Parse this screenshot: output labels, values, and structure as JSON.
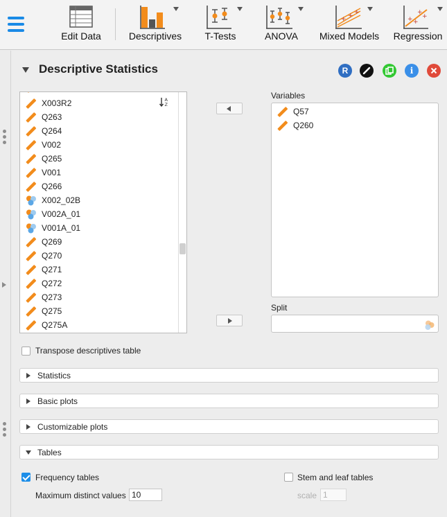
{
  "ribbon": {
    "menu_icon": "hamburger-menu-icon",
    "buttons": [
      {
        "label": "Edit Data",
        "icon": "table-grid-icon"
      },
      {
        "label": "Descriptives",
        "icon": "bar-chart-icon"
      },
      {
        "label": "T-Tests",
        "icon": "t-test-icon"
      },
      {
        "label": "ANOVA",
        "icon": "anova-icon"
      },
      {
        "label": "Mixed Models",
        "icon": "mixed-models-icon"
      },
      {
        "label": "Regression",
        "icon": "regression-icon"
      }
    ],
    "accent_color": "#f28c1c",
    "menu_color": "#1a8ae6"
  },
  "analysis": {
    "title": "Descriptive Statistics",
    "header_icons": [
      {
        "name": "r-syntax-icon",
        "glyph": "R",
        "color": "#2f6ec2"
      },
      {
        "name": "edit-title-icon",
        "glyph": "",
        "color": "#111111"
      },
      {
        "name": "duplicate-icon",
        "glyph": "",
        "color": "#32c832"
      },
      {
        "name": "info-icon",
        "glyph": "i",
        "color": "#3a8fe8"
      },
      {
        "name": "close-icon",
        "glyph": "",
        "color": "#e04a3a"
      }
    ]
  },
  "source_variables": [
    {
      "name": "X003R2",
      "type": "scale"
    },
    {
      "name": "Q263",
      "type": "scale"
    },
    {
      "name": "Q264",
      "type": "scale"
    },
    {
      "name": "V002",
      "type": "scale"
    },
    {
      "name": "Q265",
      "type": "scale"
    },
    {
      "name": "V001",
      "type": "scale"
    },
    {
      "name": "Q266",
      "type": "scale"
    },
    {
      "name": "X002_02B",
      "type": "nominal"
    },
    {
      "name": "V002A_01",
      "type": "nominal"
    },
    {
      "name": "V001A_01",
      "type": "nominal"
    },
    {
      "name": "Q269",
      "type": "scale"
    },
    {
      "name": "Q270",
      "type": "scale"
    },
    {
      "name": "Q271",
      "type": "scale"
    },
    {
      "name": "Q272",
      "type": "scale"
    },
    {
      "name": "Q273",
      "type": "scale"
    },
    {
      "name": "Q275",
      "type": "scale"
    },
    {
      "name": "Q275A",
      "type": "scale"
    }
  ],
  "variables_box": {
    "label": "Variables",
    "items": [
      {
        "name": "Q57",
        "type": "scale"
      },
      {
        "name": "Q260",
        "type": "scale"
      }
    ]
  },
  "split_box": {
    "label": "Split",
    "icon": "nominal-variable-icon"
  },
  "options": {
    "transpose_label": "Transpose descriptives table",
    "transpose_checked": false
  },
  "sections": [
    {
      "label": "Statistics",
      "expanded": false
    },
    {
      "label": "Basic plots",
      "expanded": false
    },
    {
      "label": "Customizable plots",
      "expanded": false
    },
    {
      "label": "Tables",
      "expanded": true
    }
  ],
  "tables": {
    "frequency_label": "Frequency tables",
    "frequency_checked": true,
    "max_distinct_label": "Maximum distinct values",
    "max_distinct_value": "10",
    "stem_leaf_label": "Stem and leaf tables",
    "stem_leaf_checked": false,
    "scale_label": "scale",
    "scale_value": "1"
  }
}
